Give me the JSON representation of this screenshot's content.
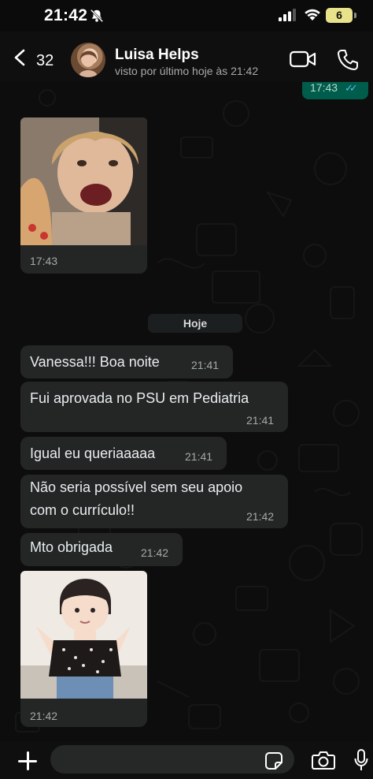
{
  "status_bar": {
    "time": "21:42",
    "battery": "6"
  },
  "header": {
    "back_count": "32",
    "contact_name": "Luisa Helps",
    "contact_status": "visto por último hoje às 21:42"
  },
  "chat": {
    "top_outgoing_time": "17:43",
    "first_image_time": "17:43",
    "date_separator": "Hoje",
    "messages": [
      {
        "text": "Vanessa!!! Boa noite",
        "time": "21:41"
      },
      {
        "text": "Fui aprovada no PSU em Pediatria",
        "time": "21:41"
      },
      {
        "text": "Igual eu queriaaaaa",
        "time": "21:41"
      },
      {
        "line1": "Não seria possível sem seu apoio",
        "line2": "com o currículo!!",
        "time": "21:42"
      },
      {
        "text": "Mto obrigada",
        "time": "21:42"
      }
    ],
    "second_image_time": "21:42"
  },
  "icons": {
    "header": [
      "back-chevron-icon",
      "video-camera-icon",
      "phone-icon"
    ],
    "input": [
      "plus-icon",
      "sticker-icon",
      "camera-icon",
      "microphone-icon"
    ]
  },
  "colors": {
    "incoming_bubble": "#242626",
    "outgoing_bubble": "#005c4b",
    "read_ticks": "#53bdeb"
  }
}
